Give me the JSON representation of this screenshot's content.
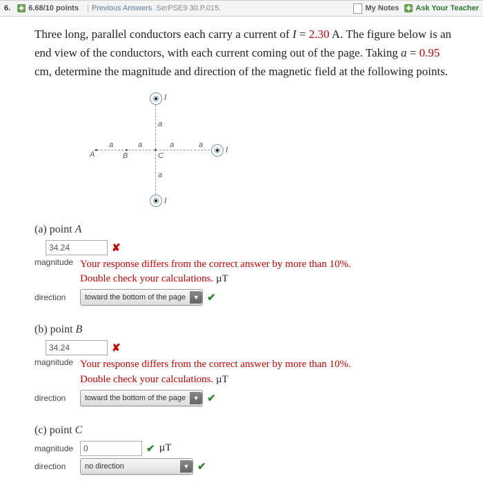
{
  "header": {
    "question_number": "6.",
    "points": "6.68/10 points",
    "previous_answers": "Previous Answers",
    "source": "SerPSE9 30.P.015.",
    "my_notes": "My Notes",
    "ask": "Ask Your Teacher"
  },
  "stem": {
    "p1a": "Three long, parallel conductors each carry a current of ",
    "p1b": " = ",
    "current_val": "2.30",
    "p1c": " A. The figure below is an end view of the conductors, with each current coming out of the page. Taking ",
    "p1d": " = ",
    "a_val": "0.95",
    "p1e": " cm, determine the magnitude and direction of the magnetic field at the following points."
  },
  "figure": {
    "I": "I",
    "A": "A",
    "B": "B",
    "C": "C",
    "a": "a"
  },
  "labels": {
    "magnitude": "magnitude",
    "direction": "direction",
    "unit": "µT"
  },
  "partA": {
    "label": "(a) point ",
    "pointName": "A",
    "mag_value": "34.24",
    "fb1": "Your response differs from the correct answer by more than 10%.",
    "fb2": "Double check your calculations.",
    "dir_value": "toward the bottom of the page"
  },
  "partB": {
    "label": "(b) point ",
    "pointName": "B",
    "mag_value": "34.24",
    "fb1": "Your response differs from the correct answer by more than 10%.",
    "fb2": "Double check your calculations.",
    "dir_value": "toward the bottom of the page"
  },
  "partC": {
    "label": "(c) point ",
    "pointName": "C",
    "mag_value": "0",
    "dir_value": "no direction"
  }
}
